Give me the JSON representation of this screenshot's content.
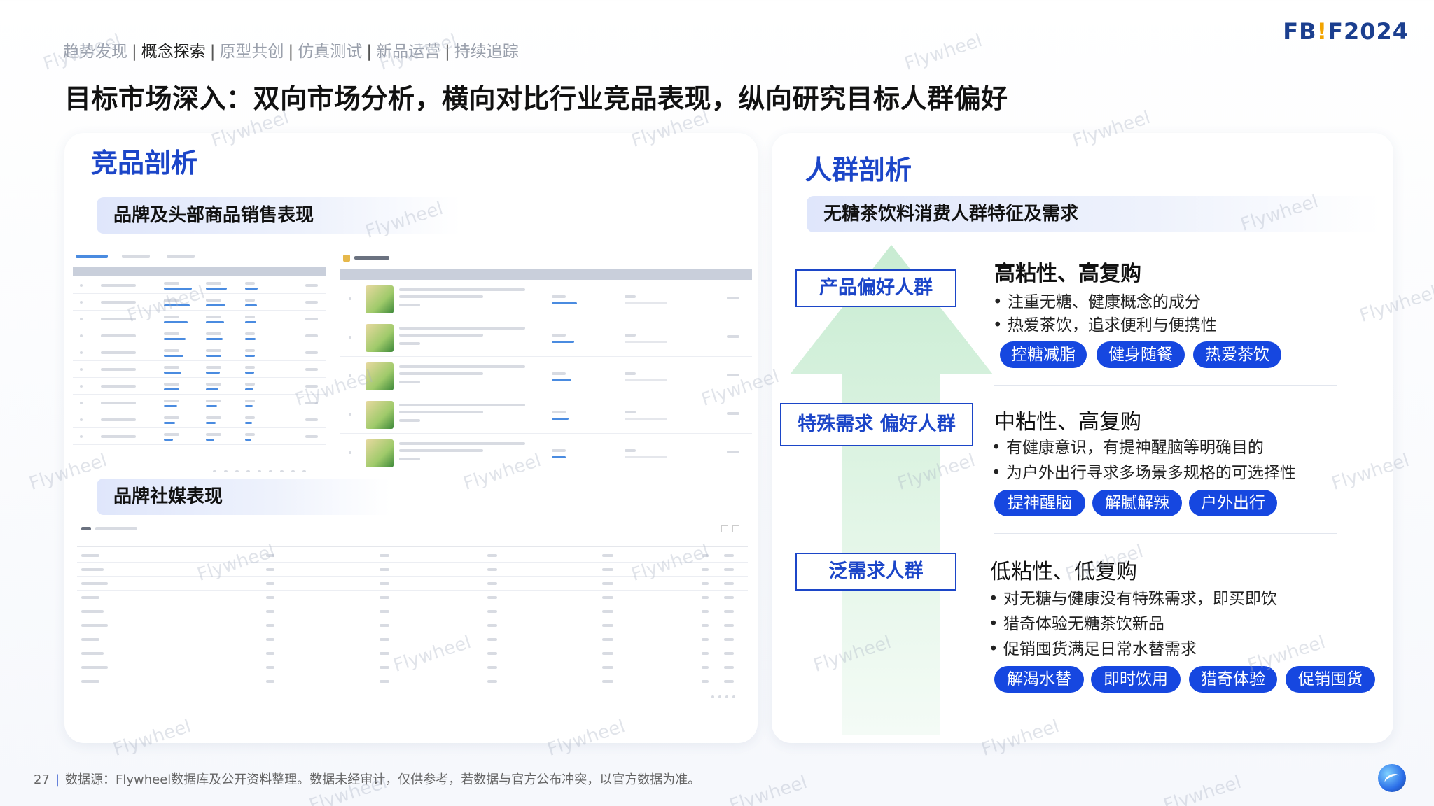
{
  "nav": {
    "items": [
      "趋势发现",
      "概念探索",
      "原型共创",
      "仿真测试",
      "新品运营",
      "持续追踪"
    ],
    "active_index": 1,
    "separator": "|"
  },
  "logo": {
    "text_pre": "FB",
    "text_bang": "!",
    "text_post": "F2024"
  },
  "title": "目标市场深入：双向市场分析，横向对比行业竞品表现，纵向研究目标人群偏好",
  "left": {
    "section_title": "竞品剖析",
    "band1": "品牌及头部商品销售表现",
    "band2": "品牌社媒表现"
  },
  "right": {
    "section_title": "人群剖析",
    "band": "无糖茶饮料消费人群特征及需求",
    "groups": [
      {
        "label": "产品偏好人群",
        "heading": "高粘性、高复购",
        "bullets": [
          "• 注重无糖、健康概念的成分",
          "• 热爱茶饮，追求便利与便携性"
        ],
        "tags": [
          "控糖减脂",
          "健身随餐",
          "热爱茶饮"
        ]
      },
      {
        "label": "特殊需求 偏好人群",
        "heading": "中粘性、高复购",
        "bullets": [
          "• 有健康意识，有提神醒脑等明确目的",
          "• 为户外出行寻求多场景多规格的可选择性"
        ],
        "tags": [
          "提神醒脑",
          "解腻解辣",
          "户外出行"
        ]
      },
      {
        "label": "泛需求人群",
        "heading": "低粘性、低复购",
        "bullets": [
          "• 对无糖与健康没有特殊需求，即买即饮",
          "• 猎奇体验无糖茶饮新品",
          "• 促销囤货满足日常水替需求"
        ],
        "tags": [
          "解渴水替",
          "即时饮用",
          "猎奇体验",
          "促销囤货"
        ]
      }
    ]
  },
  "footer": {
    "page": "27",
    "source": "数据源：Flywheel数据库及公开资料整理。数据未经审计，仅供参考，若数据与官方公布冲突，以官方数据为准。"
  },
  "watermark": "Flywheel",
  "colors": {
    "brand_blue": "#1c46c8",
    "pill_blue": "#1647e0",
    "arrow_green": "#dff4e4",
    "logo_navy": "#1b3f8f",
    "logo_accent": "#f2a400"
  }
}
